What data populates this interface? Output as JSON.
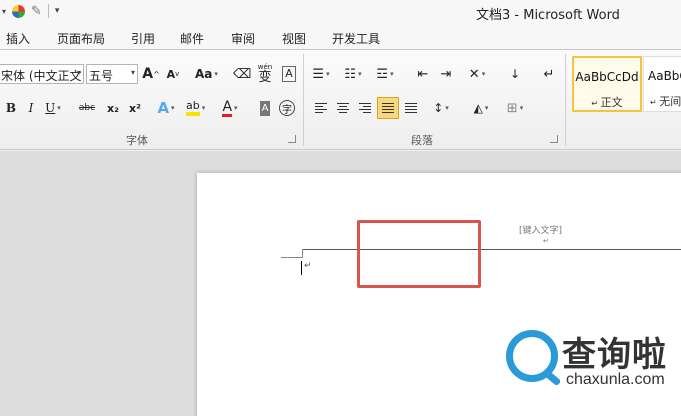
{
  "window": {
    "title": "文档3 - Microsoft Word"
  },
  "quick_access": {
    "icons": [
      "dropdown-arrow-icon",
      "color-palette-icon",
      "format-painter-icon",
      "customize-icon"
    ]
  },
  "tabs": [
    {
      "label": "插入"
    },
    {
      "label": "页面布局"
    },
    {
      "label": "引用"
    },
    {
      "label": "邮件"
    },
    {
      "label": "审阅"
    },
    {
      "label": "视图"
    },
    {
      "label": "开发工具"
    }
  ],
  "font": {
    "family": "宋体 (中文正文",
    "size": "五号",
    "grow": "A",
    "shrink": "A",
    "case": "Aa",
    "phonetic": "wén",
    "enclose": "变",
    "border_char": "A",
    "bold": "B",
    "italic": "I",
    "underline": "U",
    "strike": "abc",
    "subscript": "x₂",
    "superscript": "x²",
    "effects": "A",
    "highlight": "ab",
    "color": "A",
    "shade": "A",
    "circle": "字",
    "group_label": "字体"
  },
  "paragraph": {
    "group_label": "段落"
  },
  "styles": [
    {
      "preview": "AaBbCcDd",
      "name": "正文",
      "selected": true
    },
    {
      "preview": "AaBbC",
      "name": "无间",
      "selected": false
    }
  ],
  "document": {
    "header_placeholder": "[键入文字]",
    "colors": {
      "highlight_box": "#d9534f",
      "accent": "#f5c241"
    }
  },
  "watermark": {
    "brand_cn": "查询啦",
    "url": "chaxunla.com"
  }
}
